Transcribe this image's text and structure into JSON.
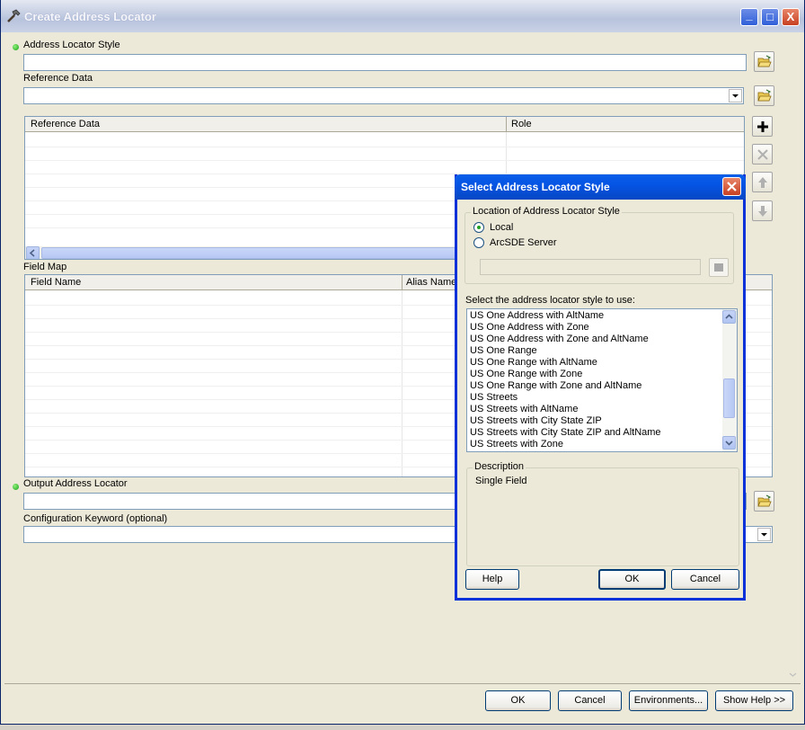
{
  "window": {
    "title": "Create Address Locator",
    "minimize": "_",
    "maximize": "□",
    "close": "X"
  },
  "form": {
    "address_locator_style_label": "Address Locator Style",
    "reference_data_label": "Reference Data",
    "ref_table_headers": [
      "Reference Data",
      "Role"
    ],
    "field_map_label": "Field Map",
    "field_map_headers": [
      "Field Name",
      "Alias Name"
    ],
    "output_label": "Output Address Locator",
    "config_keyword_label": "Configuration Keyword (optional)"
  },
  "footer": {
    "ok": "OK",
    "cancel": "Cancel",
    "environments": "Environments...",
    "show_help": "Show Help >>"
  },
  "dialog": {
    "title": "Select Address Locator Style",
    "location_group": "Location of Address Locator Style",
    "local": "Local",
    "arcsde": "ArcSDE Server",
    "select_prompt": "Select the address locator style to use:",
    "styles": [
      "US One Address with AltName",
      "US One Address with Zone",
      "US One Address with Zone and AltName",
      "US One Range",
      "US One Range with AltName",
      "US One Range with Zone",
      "US One Range with Zone and AltName",
      "US Streets",
      "US Streets with AltName",
      "US Streets with City State ZIP",
      "US Streets with City State ZIP and AltName",
      "US Streets with Zone"
    ],
    "description_label": "Description",
    "description_text": "Single Field",
    "help": "Help",
    "ok": "OK",
    "cancel": "Cancel"
  },
  "colors": {
    "accent": "#0a5fe8",
    "required_dot": "#1aa31a"
  }
}
